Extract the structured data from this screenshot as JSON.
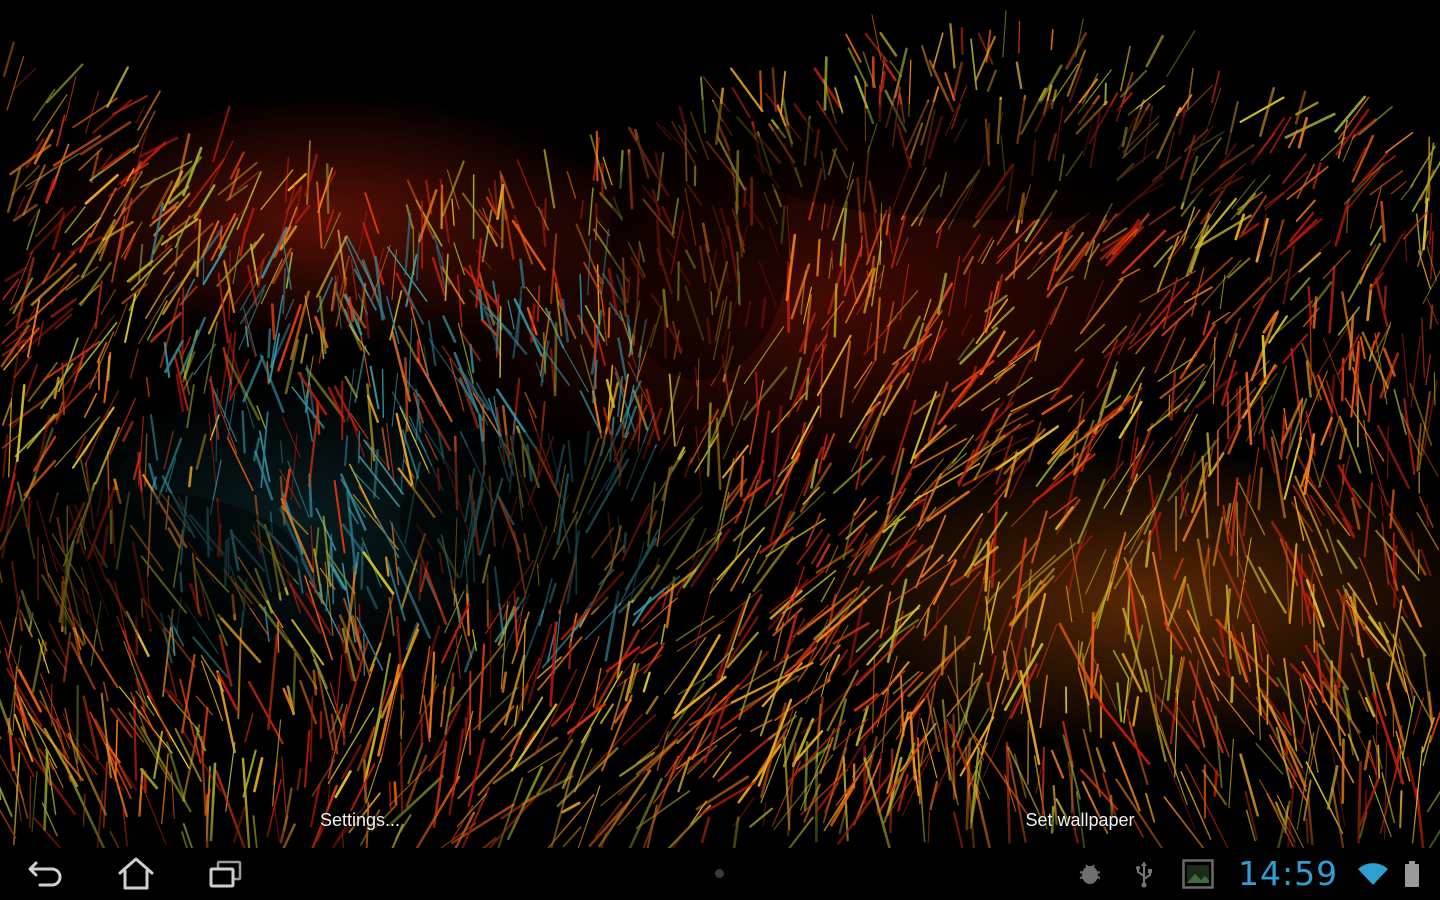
{
  "wallpaper_preview": {
    "actions": {
      "settings_label": "Settings...",
      "set_wallpaper_label": "Set wallpaper"
    }
  },
  "system_bar": {
    "nav": [
      {
        "name": "back",
        "icon": "back-icon"
      },
      {
        "name": "home",
        "icon": "home-icon"
      },
      {
        "name": "recent-apps",
        "icon": "recent-apps-icon"
      }
    ],
    "status_icons": [
      "android-debug-icon",
      "usb-icon",
      "gallery-notification-icon"
    ],
    "clock": "14:59",
    "wifi_icon": "wifi-icon",
    "battery_icon": "battery-icon",
    "accent_color": "#2f9fd3"
  }
}
